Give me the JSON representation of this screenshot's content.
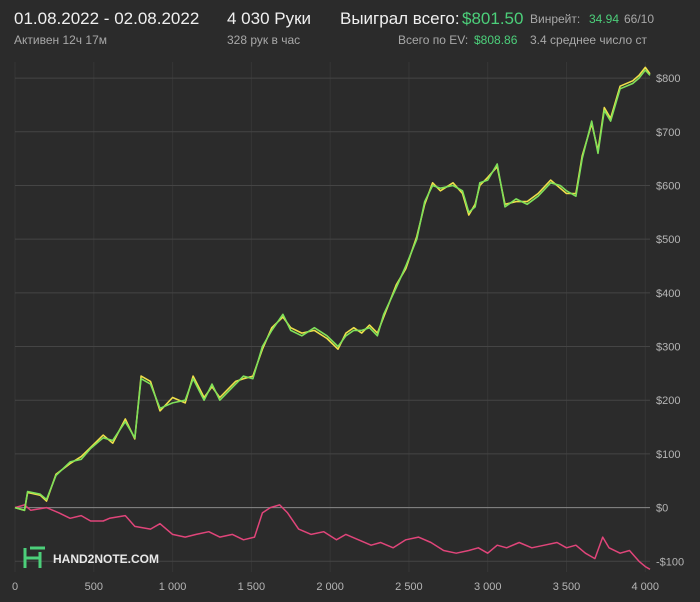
{
  "header": {
    "date_range": "01.08.2022 - 02.08.2022",
    "active_label": "Активен 12ч 17м",
    "hands": "4 030 Руки",
    "hands_per_hour": "328 рук в час",
    "won_label": "Выиграл всего:",
    "won_value": "$801.50",
    "ev_label": "Всего по EV:",
    "ev_value": "$808.86",
    "winrate_label": "Винрейт:",
    "winrate_value": "34.94",
    "winrate_extra": "66/10",
    "avg_label": "3.4 среднее число ст"
  },
  "logo": {
    "text": "HAND2NOTE.COM"
  },
  "colors": {
    "won": "#7ee05a",
    "ev": "#f0e04a",
    "sd": "#e0457a",
    "accent": "#4ccf7a"
  },
  "chart_data": {
    "type": "line",
    "xlim": [
      0,
      4030
    ],
    "ylim": [
      -120,
      830
    ],
    "x_ticks": [
      0,
      500,
      1000,
      1500,
      2000,
      2500,
      3000,
      3500,
      4000
    ],
    "x_tick_labels": [
      "0",
      "500",
      "1 000",
      "1 500",
      "2 000",
      "2 500",
      "3 000",
      "3 500",
      "4 000"
    ],
    "y_ticks": [
      -100,
      0,
      100,
      200,
      300,
      400,
      500,
      600,
      700,
      800
    ],
    "y_tick_labels": [
      "-$100",
      "$0",
      "$100",
      "$200",
      "$300",
      "$400",
      "$500",
      "$600",
      "$700",
      "$800"
    ],
    "series": [
      {
        "key": "won",
        "points": [
          [
            0,
            0
          ],
          [
            60,
            -5
          ],
          [
            80,
            30
          ],
          [
            160,
            25
          ],
          [
            200,
            15
          ],
          [
            260,
            60
          ],
          [
            350,
            85
          ],
          [
            420,
            90
          ],
          [
            480,
            110
          ],
          [
            560,
            130
          ],
          [
            620,
            125
          ],
          [
            700,
            160
          ],
          [
            760,
            130
          ],
          [
            800,
            240
          ],
          [
            860,
            230
          ],
          [
            920,
            185
          ],
          [
            1000,
            195
          ],
          [
            1080,
            200
          ],
          [
            1130,
            240
          ],
          [
            1200,
            200
          ],
          [
            1250,
            230
          ],
          [
            1300,
            200
          ],
          [
            1400,
            230
          ],
          [
            1450,
            245
          ],
          [
            1510,
            240
          ],
          [
            1570,
            300
          ],
          [
            1630,
            330
          ],
          [
            1700,
            360
          ],
          [
            1750,
            330
          ],
          [
            1820,
            320
          ],
          [
            1900,
            335
          ],
          [
            1980,
            320
          ],
          [
            2050,
            300
          ],
          [
            2100,
            320
          ],
          [
            2150,
            330
          ],
          [
            2200,
            330
          ],
          [
            2250,
            335
          ],
          [
            2300,
            320
          ],
          [
            2340,
            360
          ],
          [
            2420,
            410
          ],
          [
            2480,
            450
          ],
          [
            2550,
            500
          ],
          [
            2600,
            570
          ],
          [
            2650,
            600
          ],
          [
            2700,
            595
          ],
          [
            2780,
            600
          ],
          [
            2840,
            590
          ],
          [
            2880,
            550
          ],
          [
            2920,
            560
          ],
          [
            2950,
            605
          ],
          [
            3000,
            610
          ],
          [
            3060,
            640
          ],
          [
            3110,
            560
          ],
          [
            3180,
            575
          ],
          [
            3250,
            565
          ],
          [
            3320,
            580
          ],
          [
            3400,
            605
          ],
          [
            3460,
            600
          ],
          [
            3500,
            590
          ],
          [
            3560,
            580
          ],
          [
            3600,
            650
          ],
          [
            3660,
            720
          ],
          [
            3700,
            660
          ],
          [
            3740,
            740
          ],
          [
            3780,
            720
          ],
          [
            3840,
            780
          ],
          [
            3920,
            790
          ],
          [
            3960,
            800
          ],
          [
            4000,
            815
          ],
          [
            4030,
            805
          ]
        ]
      },
      {
        "key": "ev",
        "points": [
          [
            0,
            0
          ],
          [
            60,
            -5
          ],
          [
            80,
            28
          ],
          [
            160,
            23
          ],
          [
            200,
            12
          ],
          [
            260,
            62
          ],
          [
            350,
            82
          ],
          [
            420,
            95
          ],
          [
            480,
            112
          ],
          [
            560,
            135
          ],
          [
            620,
            120
          ],
          [
            700,
            165
          ],
          [
            760,
            128
          ],
          [
            800,
            245
          ],
          [
            860,
            235
          ],
          [
            920,
            180
          ],
          [
            1000,
            205
          ],
          [
            1080,
            195
          ],
          [
            1130,
            245
          ],
          [
            1200,
            205
          ],
          [
            1250,
            225
          ],
          [
            1300,
            205
          ],
          [
            1400,
            235
          ],
          [
            1450,
            240
          ],
          [
            1510,
            245
          ],
          [
            1570,
            295
          ],
          [
            1630,
            335
          ],
          [
            1700,
            355
          ],
          [
            1750,
            335
          ],
          [
            1820,
            325
          ],
          [
            1900,
            330
          ],
          [
            1980,
            315
          ],
          [
            2050,
            295
          ],
          [
            2100,
            325
          ],
          [
            2150,
            335
          ],
          [
            2200,
            325
          ],
          [
            2250,
            340
          ],
          [
            2300,
            325
          ],
          [
            2340,
            355
          ],
          [
            2420,
            415
          ],
          [
            2480,
            445
          ],
          [
            2550,
            505
          ],
          [
            2600,
            565
          ],
          [
            2650,
            605
          ],
          [
            2700,
            590
          ],
          [
            2780,
            605
          ],
          [
            2840,
            585
          ],
          [
            2880,
            545
          ],
          [
            2920,
            565
          ],
          [
            2950,
            600
          ],
          [
            3000,
            615
          ],
          [
            3060,
            635
          ],
          [
            3110,
            565
          ],
          [
            3180,
            570
          ],
          [
            3250,
            570
          ],
          [
            3320,
            585
          ],
          [
            3400,
            610
          ],
          [
            3460,
            595
          ],
          [
            3500,
            585
          ],
          [
            3560,
            585
          ],
          [
            3600,
            655
          ],
          [
            3660,
            715
          ],
          [
            3700,
            665
          ],
          [
            3740,
            745
          ],
          [
            3780,
            725
          ],
          [
            3840,
            785
          ],
          [
            3920,
            795
          ],
          [
            3960,
            805
          ],
          [
            4000,
            820
          ],
          [
            4030,
            808
          ]
        ]
      },
      {
        "key": "sd",
        "points": [
          [
            0,
            0
          ],
          [
            60,
            5
          ],
          [
            100,
            -5
          ],
          [
            200,
            0
          ],
          [
            280,
            -10
          ],
          [
            350,
            -20
          ],
          [
            420,
            -15
          ],
          [
            480,
            -25
          ],
          [
            560,
            -25
          ],
          [
            600,
            -20
          ],
          [
            700,
            -15
          ],
          [
            760,
            -35
          ],
          [
            860,
            -40
          ],
          [
            920,
            -30
          ],
          [
            1000,
            -50
          ],
          [
            1080,
            -55
          ],
          [
            1150,
            -50
          ],
          [
            1230,
            -45
          ],
          [
            1300,
            -55
          ],
          [
            1380,
            -50
          ],
          [
            1450,
            -60
          ],
          [
            1520,
            -55
          ],
          [
            1570,
            -10
          ],
          [
            1620,
            0
          ],
          [
            1680,
            5
          ],
          [
            1730,
            -10
          ],
          [
            1800,
            -40
          ],
          [
            1880,
            -50
          ],
          [
            1960,
            -45
          ],
          [
            2040,
            -60
          ],
          [
            2100,
            -50
          ],
          [
            2180,
            -60
          ],
          [
            2260,
            -70
          ],
          [
            2320,
            -65
          ],
          [
            2400,
            -75
          ],
          [
            2480,
            -60
          ],
          [
            2560,
            -55
          ],
          [
            2640,
            -65
          ],
          [
            2720,
            -80
          ],
          [
            2800,
            -85
          ],
          [
            2880,
            -80
          ],
          [
            2940,
            -75
          ],
          [
            3000,
            -85
          ],
          [
            3060,
            -70
          ],
          [
            3120,
            -75
          ],
          [
            3200,
            -65
          ],
          [
            3280,
            -75
          ],
          [
            3360,
            -70
          ],
          [
            3440,
            -65
          ],
          [
            3500,
            -75
          ],
          [
            3560,
            -70
          ],
          [
            3620,
            -85
          ],
          [
            3680,
            -95
          ],
          [
            3730,
            -55
          ],
          [
            3770,
            -75
          ],
          [
            3840,
            -85
          ],
          [
            3900,
            -80
          ],
          [
            3960,
            -100
          ],
          [
            4000,
            -110
          ],
          [
            4030,
            -115
          ]
        ]
      }
    ]
  }
}
